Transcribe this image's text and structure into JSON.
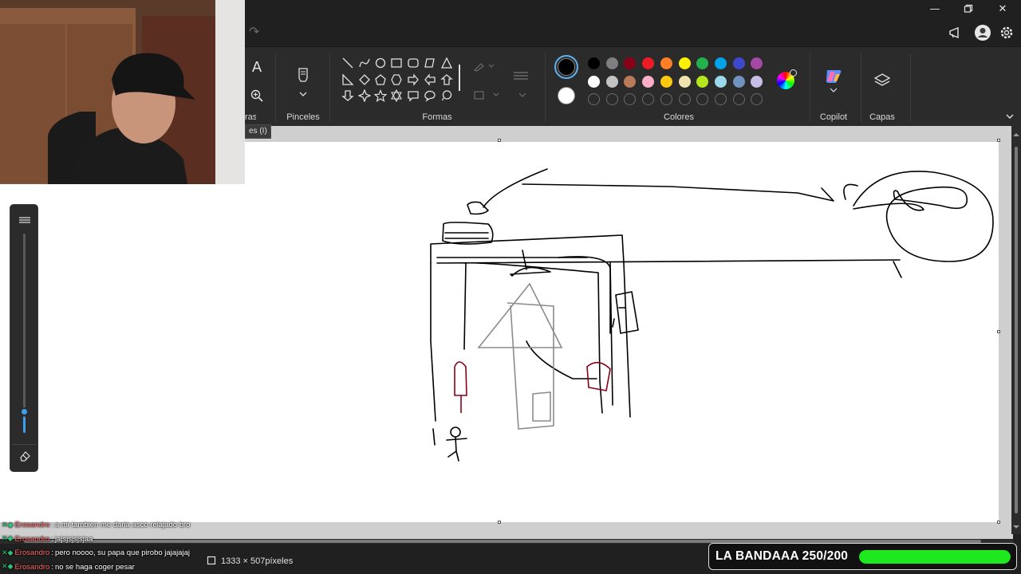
{
  "ribbon": {
    "groups": {
      "text_tool": "A",
      "tools_label_fragment": "ras",
      "brushes": "Pinceles",
      "shapes": "Formas",
      "colors": "Colores",
      "copilot": "Copilot",
      "layers": "Capas"
    },
    "tooltip": "es (I)",
    "primary_color": "#000000",
    "secondary_color": "#ffffff",
    "palette_row1": [
      "#000000",
      "#7f7f7f",
      "#880015",
      "#ed1c24",
      "#ff7f27",
      "#fff200",
      "#22b14c",
      "#00a2e8",
      "#3f48cc",
      "#a349a4"
    ],
    "palette_row2": [
      "#ffffff",
      "#c3c3c3",
      "#b97a57",
      "#ffaec9",
      "#ffc90e",
      "#efe4b0",
      "#b5e61d",
      "#99d9ea",
      "#7092be",
      "#c8bfe7"
    ]
  },
  "status": {
    "canvas_size": "1333 × 507píxeles"
  },
  "chat": {
    "messages": [
      {
        "user": "Erosandro",
        "text": "a mi tambien me daria asco relajado bro"
      },
      {
        "user": "Erosandro",
        "text": "jajsjsjsjsjaa"
      },
      {
        "user": "Erosandro",
        "text": "pero noooo, su papa que pirobo jajajajaj"
      },
      {
        "user": "Erosandro",
        "text": "no se haga coger pesar"
      }
    ]
  },
  "goal": {
    "label": "LA BANDAAA 250/200",
    "progress_fraction": 1.0,
    "color": "#1ee81e"
  },
  "icons": [
    "minimize-icon",
    "maximize-icon",
    "close-icon",
    "redo-icon",
    "megaphone-icon",
    "account-icon",
    "settings-icon",
    "text-icon",
    "zoom-icon",
    "brush-icon",
    "color-wheel-icon",
    "copilot-icon",
    "layers-icon",
    "eraser-icon",
    "chevron-down-icon",
    "canvas-size-icon"
  ]
}
